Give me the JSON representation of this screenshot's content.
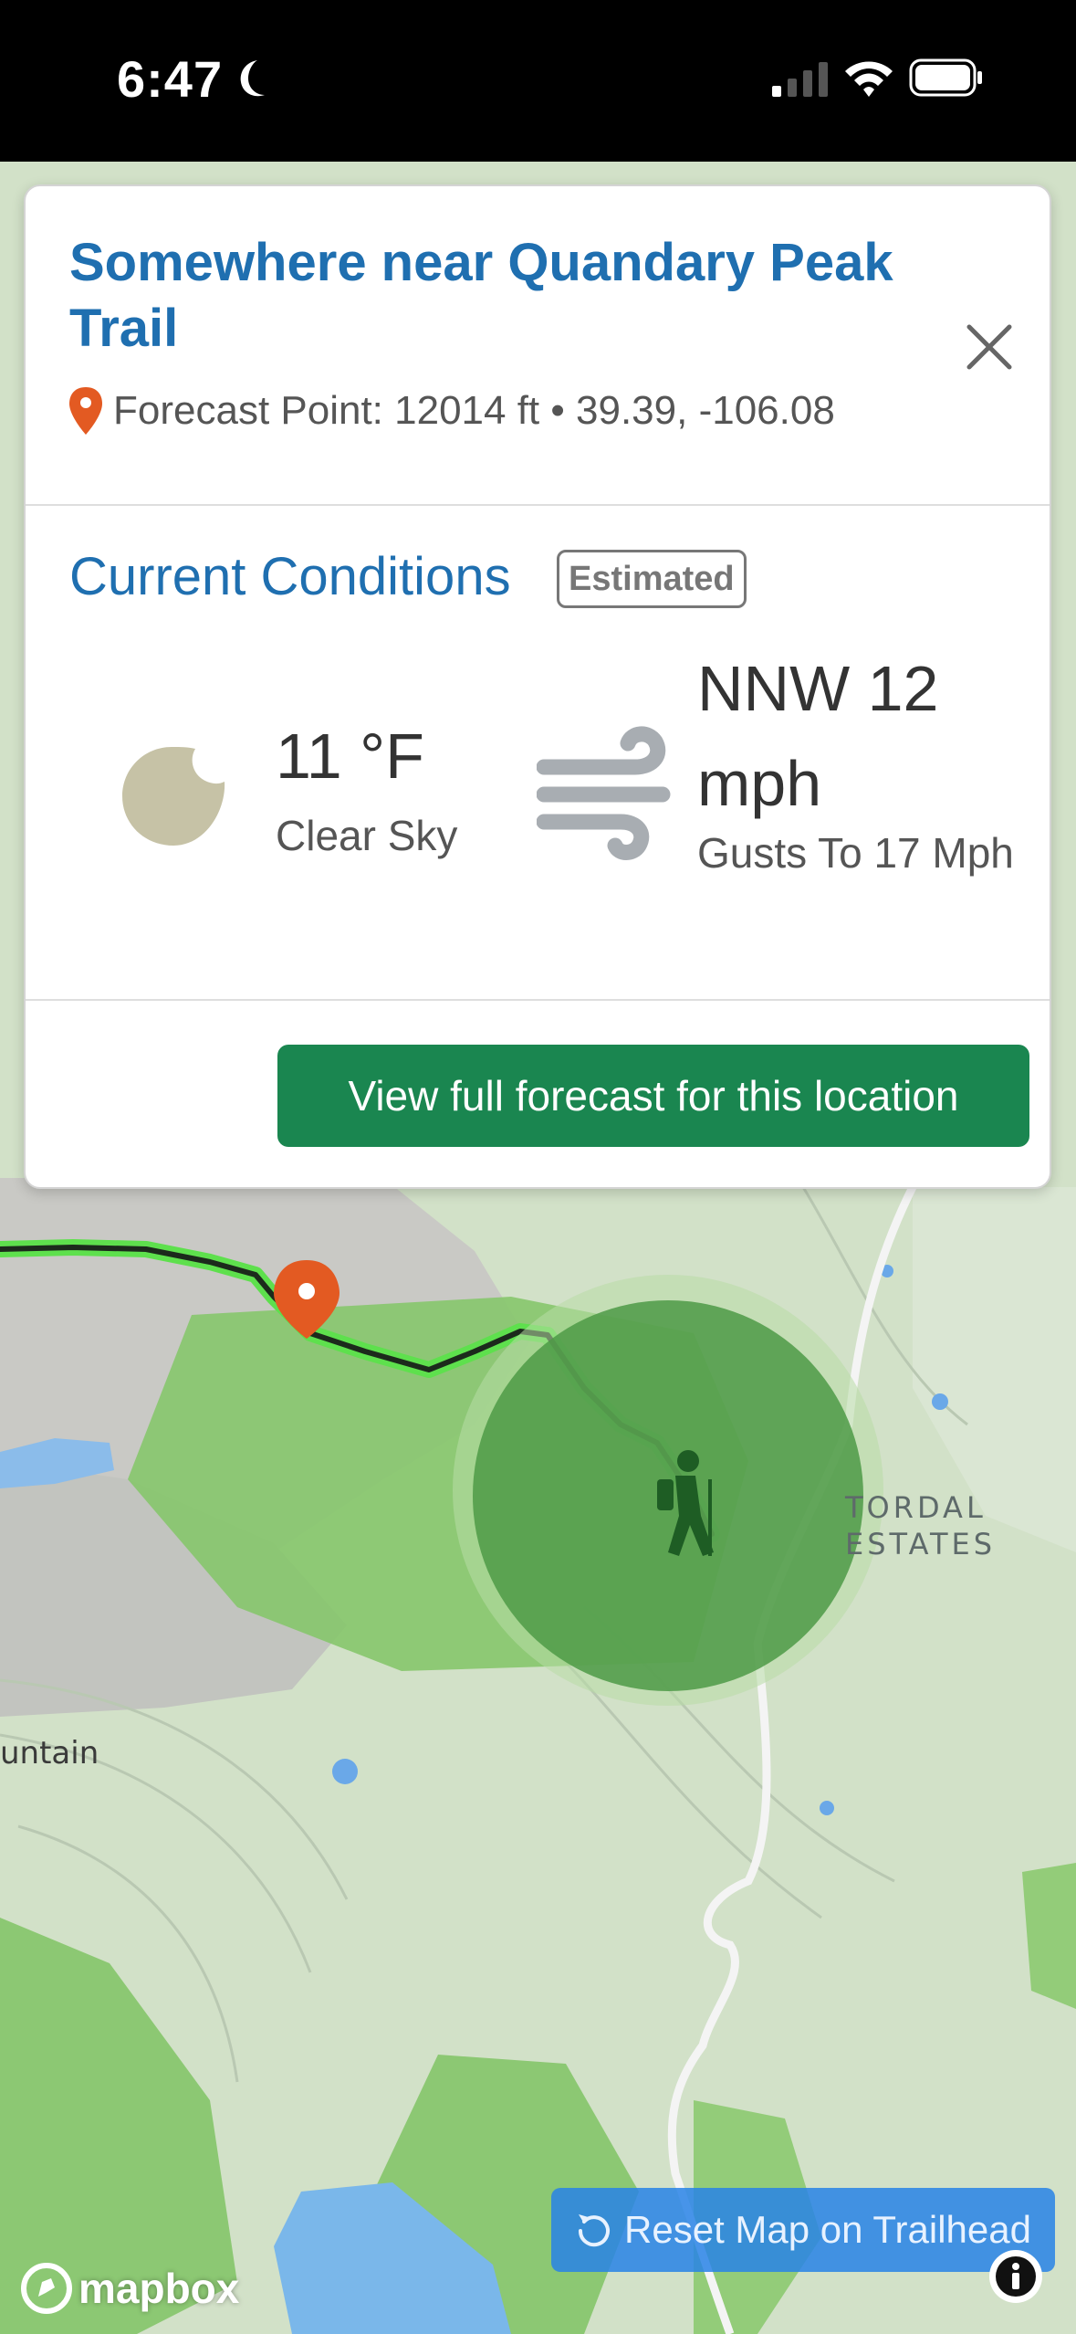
{
  "status_bar": {
    "time": "6:47"
  },
  "card": {
    "title": "Somewhere near Quandary Peak Trail",
    "forecast_point": "Forecast Point: 12014 ft • 39.39, -106.08",
    "conditions_title": "Current Conditions",
    "estimated_label": "Estimated",
    "temperature": "11 °F",
    "sky": "Clear Sky",
    "wind_speed": "NNW 12 mph",
    "gusts": "Gusts To 17 Mph",
    "forecast_button": "View full forecast for this location"
  },
  "map": {
    "labels": {
      "place_line1": "TORDAL",
      "place_line2": "ESTATES",
      "mountain": "untain"
    },
    "reset_button": "Reset Map on Trailhead",
    "attribution": "mapbox"
  },
  "colors": {
    "title_blue": "#1f6fb0",
    "button_green": "#1a8650",
    "pin_orange": "#e35a22",
    "reset_blue": "#2882e6",
    "trail_green": "#55d44a"
  }
}
